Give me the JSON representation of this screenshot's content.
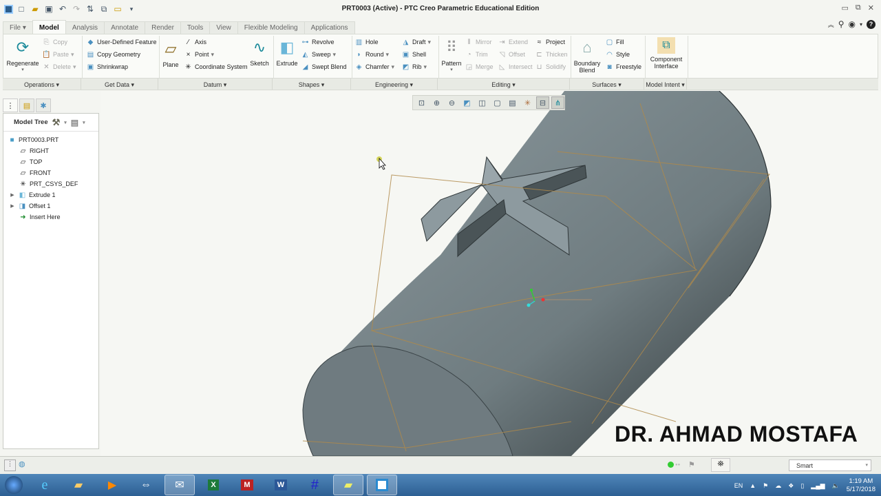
{
  "window": {
    "title": "PRT0003 (Active) - PTC Creo Parametric Educational Edition"
  },
  "quick_access": [
    "app-icon",
    "new-icon",
    "open-icon",
    "save-icon",
    "undo-icon",
    "redo-icon",
    "regenerate-icon",
    "windows-icon",
    "close-window-icon",
    "customize-icon"
  ],
  "tabs": [
    {
      "label": "File ▾",
      "active": false
    },
    {
      "label": "Model",
      "active": true
    },
    {
      "label": "Analysis",
      "active": false
    },
    {
      "label": "Annotate",
      "active": false
    },
    {
      "label": "Render",
      "active": false
    },
    {
      "label": "Tools",
      "active": false
    },
    {
      "label": "View",
      "active": false
    },
    {
      "label": "Flexible Modeling",
      "active": false
    },
    {
      "label": "Applications",
      "active": false
    }
  ],
  "ribbon": {
    "operations": {
      "regenerate": "Regenerate",
      "copy": "Copy",
      "paste": "Paste",
      "delete": "Delete"
    },
    "get_data": {
      "udf": "User-Defined Feature",
      "copy_geometry": "Copy Geometry",
      "shrinkwrap": "Shrinkwrap"
    },
    "datum": {
      "plane": "Plane",
      "axis": "Axis",
      "point": "Point",
      "csys": "Coordinate System",
      "sketch": "Sketch"
    },
    "shapes": {
      "extrude": "Extrude",
      "revolve": "Revolve",
      "sweep": "Sweep",
      "swept_blend": "Swept Blend"
    },
    "engineering": {
      "hole": "Hole",
      "round": "Round",
      "chamfer": "Chamfer",
      "draft": "Draft",
      "shell": "Shell",
      "rib": "Rib"
    },
    "editing": {
      "pattern": "Pattern",
      "mirror": "Mirror",
      "trim": "Trim",
      "merge": "Merge",
      "extend": "Extend",
      "offset": "Offset",
      "intersect": "Intersect",
      "project": "Project",
      "thicken": "Thicken",
      "solidify": "Solidify"
    },
    "surfaces": {
      "boundary_blend_1": "Boundary",
      "boundary_blend_2": "Blend",
      "fill": "Fill",
      "style": "Style",
      "freestyle": "Freestyle"
    },
    "model_intent": {
      "component_interface_1": "Component",
      "component_interface_2": "Interface"
    },
    "group_labels": [
      "Operations ▾",
      "Get Data ▾",
      "Datum ▾",
      "Shapes ▾",
      "Engineering ▾",
      "Editing ▾",
      "Surfaces ▾",
      "Model Intent ▾"
    ]
  },
  "model_tree": {
    "title": "Model Tree",
    "items": [
      {
        "label": "PRT0003.PRT",
        "icon": "part-icon",
        "expandable": false,
        "indent": 0
      },
      {
        "label": "RIGHT",
        "icon": "datum-plane-icon",
        "expandable": false,
        "indent": 1
      },
      {
        "label": "TOP",
        "icon": "datum-plane-icon",
        "expandable": false,
        "indent": 1
      },
      {
        "label": "FRONT",
        "icon": "datum-plane-icon",
        "expandable": false,
        "indent": 1
      },
      {
        "label": "PRT_CSYS_DEF",
        "icon": "csys-icon",
        "expandable": false,
        "indent": 1
      },
      {
        "label": "Extrude 1",
        "icon": "extrude-icon",
        "expandable": true,
        "indent": 1
      },
      {
        "label": "Offset 1",
        "icon": "offset-icon",
        "expandable": true,
        "indent": 1
      },
      {
        "label": "Insert Here",
        "icon": "insert-arrow-icon",
        "expandable": false,
        "indent": 1
      }
    ]
  },
  "view_toolbar": [
    "refit-icon",
    "zoom-in-icon",
    "zoom-out-icon",
    "repaint-icon",
    "display-style-icon",
    "saved-orientations-icon",
    "view-manager-icon",
    "datum-display-icon",
    "spin-center-icon",
    "annotation-display-icon"
  ],
  "watermark": "DR. AHMAD MOSTAFA",
  "status": {
    "filter": "Smart"
  },
  "taskbar": {
    "apps": [
      "start",
      "internet-explorer",
      "file-explorer",
      "media-player",
      "teamviewer",
      "thunderbird",
      "excel",
      "mendeley",
      "word",
      "notation-app",
      "sticky-notes",
      "creo"
    ],
    "language": "EN",
    "time": "1:19 AM",
    "date": "5/17/2018"
  },
  "colors": {
    "model_gray": "#7f8c91",
    "datum_orange": "#b08a4a",
    "ribbon_bg": "#fafbf8",
    "taskbar_blue": "#3a6ea5"
  }
}
